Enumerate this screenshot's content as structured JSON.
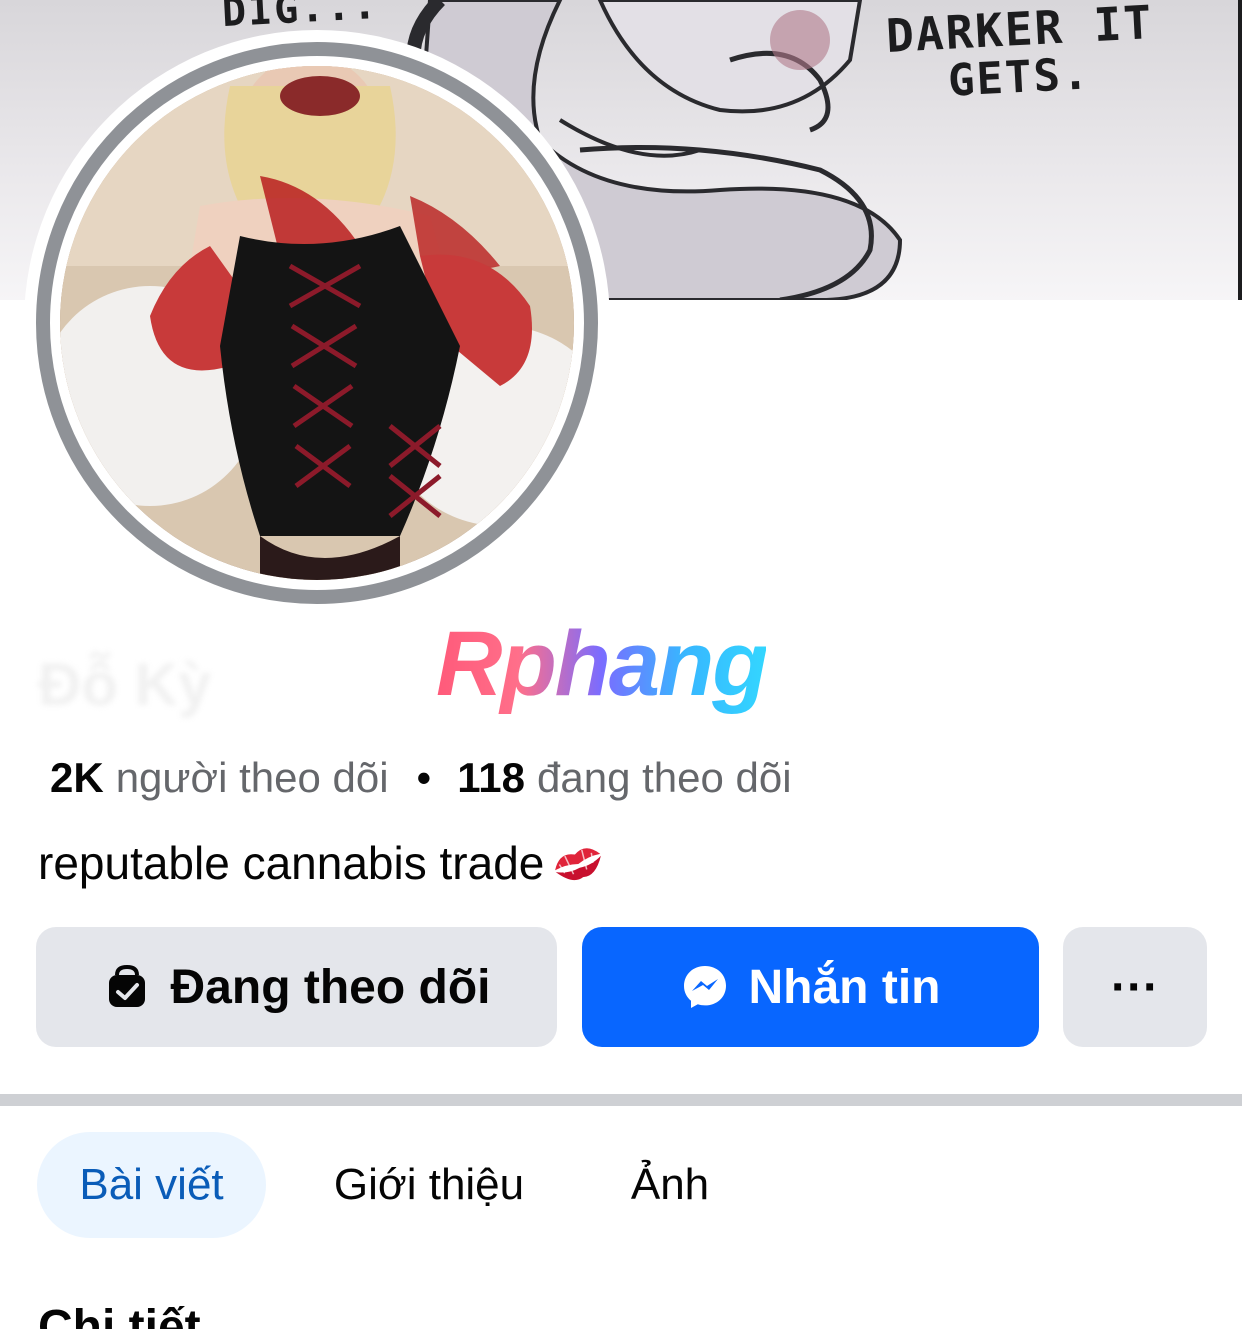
{
  "cover": {
    "text_top": "DIG...",
    "text_right_line1": "DARKER IT",
    "text_right_line2": "GETS."
  },
  "profile": {
    "name": "Đỗ Kỳ",
    "watermark": "Rphang",
    "followers_count": "2K",
    "followers_label": "người theo dõi",
    "separator": "•",
    "following_count": "118",
    "following_label": "đang theo dõi",
    "bio": "reputable cannabis trade",
    "bio_emoji_icon": "kiss-mark-icon"
  },
  "actions": {
    "following_label": "Đang theo dõi",
    "following_icon": "following-check-icon",
    "message_label": "Nhắn tin",
    "message_icon": "messenger-icon",
    "more_label": "···"
  },
  "tabs": [
    {
      "label": "Bài viết",
      "active": true
    },
    {
      "label": "Giới thiệu",
      "active": false
    },
    {
      "label": "Ảnh",
      "active": false
    }
  ],
  "details": {
    "title": "Chi tiết"
  },
  "colors": {
    "primary_blue": "#0866ff",
    "button_gray": "#e4e6eb",
    "active_tab_bg": "#ebf5ff",
    "active_tab_text": "#0a5cb8"
  }
}
